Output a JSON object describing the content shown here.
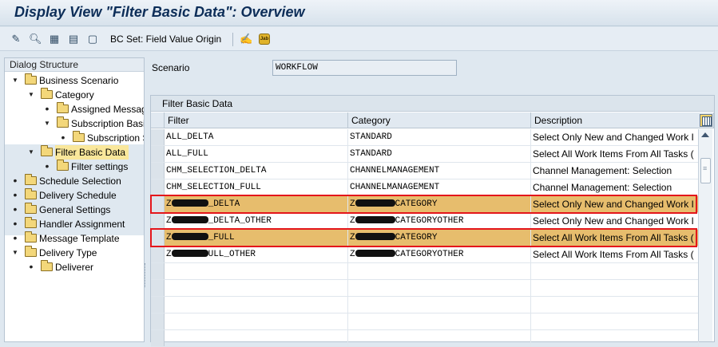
{
  "window": {
    "title": "Display View \"Filter Basic Data\": Overview"
  },
  "toolbar": {
    "icons": [
      "pencil-glasses-icon",
      "display-icon",
      "select-all-icon",
      "select-block-icon",
      "deselect-icon",
      "bc-set-icon",
      "jab-icon"
    ],
    "bc_set_label": "BC Set: Field Value Origin",
    "jab_label": "Jab"
  },
  "dialog_structure": {
    "title": "Dialog Structure",
    "items": [
      {
        "label": "Business Scenario",
        "level": 0,
        "state": "expanded"
      },
      {
        "label": "Category",
        "level": 1,
        "state": "expanded"
      },
      {
        "label": "Assigned Message",
        "level": 2,
        "state": "leaf"
      },
      {
        "label": "Subscription Basic",
        "level": 2,
        "state": "expanded"
      },
      {
        "label": "Subscription S",
        "level": 3,
        "state": "leaf"
      },
      {
        "label": "Filter Basic Data",
        "level": 1,
        "state": "expanded",
        "selected": true
      },
      {
        "label": "Filter settings",
        "level": 2,
        "state": "leaf"
      },
      {
        "label": "Schedule Selection",
        "level": 0,
        "state": "leaf"
      },
      {
        "label": "Delivery Schedule",
        "level": 0,
        "state": "leaf"
      },
      {
        "label": "General Settings",
        "level": 0,
        "state": "leaf"
      },
      {
        "label": "Handler Assignment",
        "level": 0,
        "state": "leaf"
      },
      {
        "label": "Message Template",
        "level": 0,
        "state": "leaf"
      },
      {
        "label": "Delivery Type",
        "level": 0,
        "state": "expanded"
      },
      {
        "label": "Deliverer",
        "level": 1,
        "state": "leaf"
      }
    ]
  },
  "scenario": {
    "label": "Scenario",
    "value": "WORKFLOW"
  },
  "table": {
    "title": "Filter Basic Data",
    "columns": [
      "Filter",
      "Category",
      "Description"
    ],
    "rows": [
      {
        "filter": "ALL_DELTA",
        "category": "STANDARD",
        "description": "Select Only New and Changed Work I",
        "highlight": false
      },
      {
        "filter": "ALL_FULL",
        "category": "STANDARD",
        "description": "Select All Work Items From All Tasks (",
        "highlight": false
      },
      {
        "filter": "CHM_SELECTION_DELTA",
        "category": "CHANNELMANAGEMENT",
        "description": "Channel Management: Selection",
        "highlight": false
      },
      {
        "filter": "CHM_SELECTION_FULL",
        "category": "CHANNELMANAGEMENT",
        "description": "Channel Management: Selection",
        "highlight": false
      },
      {
        "filter_pre": "Z",
        "filter_post": "_DELTA",
        "category_pre": "Z",
        "category_post": "CATEGORY",
        "description": "Select Only New and Changed Work I",
        "highlight": true
      },
      {
        "filter_pre": "Z",
        "filter_post": "_DELTA_OTHER",
        "category_pre": "Z",
        "category_post": "CATEGORYOTHER",
        "description": "Select Only New and Changed Work I",
        "highlight": false
      },
      {
        "filter_pre": "Z",
        "filter_post": "_FULL",
        "category_pre": "Z",
        "category_post": "CATEGORY",
        "description": "Select All Work Items From All Tasks (",
        "highlight": true
      },
      {
        "filter_pre": "Z",
        "filter_post": "ULL_OTHER",
        "category_pre": "Z",
        "category_post": "CATEGORYOTHER",
        "description": "Select All Work Items From All Tasks (",
        "highlight": false
      },
      {
        "filter": "",
        "category": "",
        "description": ""
      },
      {
        "filter": "",
        "category": "",
        "description": ""
      },
      {
        "filter": "",
        "category": "",
        "description": ""
      },
      {
        "filter": "",
        "category": "",
        "description": ""
      },
      {
        "filter": "",
        "category": "",
        "description": ""
      }
    ]
  }
}
